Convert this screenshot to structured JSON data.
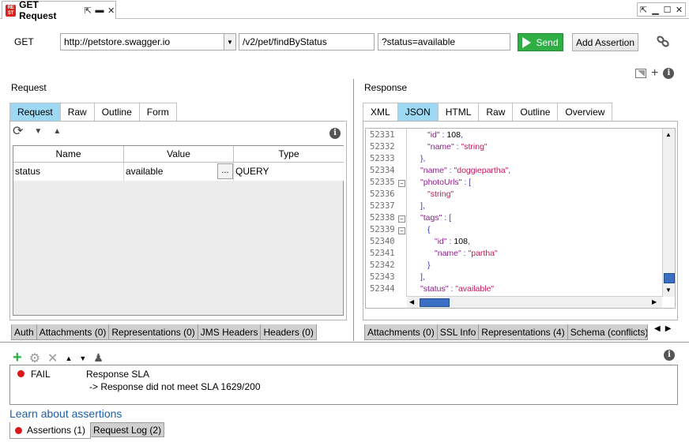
{
  "window": {
    "tab_title": "GET Request",
    "logo_text": "RE ST"
  },
  "request_line": {
    "method": "GET",
    "endpoint": "http://petstore.swagger.io",
    "resource": "/v2/pet/findByStatus",
    "query": "?status=available",
    "send_label": "Send",
    "add_assertion_label": "Add Assertion"
  },
  "request": {
    "section_title": "Request",
    "tabs": [
      "Request",
      "Raw",
      "Outline",
      "Form"
    ],
    "active_tab": "Request",
    "columns": [
      "Name",
      "Value",
      "Type"
    ],
    "rows": [
      {
        "name": "status",
        "value": "available",
        "type": "QUERY"
      }
    ],
    "ellipsis": "...",
    "bottom_tabs": [
      "Auth",
      "Attachments (0)",
      "Representations (0)",
      "JMS Headers",
      "Headers (0)"
    ]
  },
  "response": {
    "section_title": "Response",
    "tabs": [
      "XML",
      "JSON",
      "HTML",
      "Raw",
      "Outline",
      "Overview"
    ],
    "active_tab": "JSON",
    "lines": [
      {
        "no": "52331",
        "fold": false,
        "indent": 2,
        "key": "\"id\"",
        "sep": " : ",
        "val": "108",
        "vtype": "n",
        "tail": ","
      },
      {
        "no": "52332",
        "fold": false,
        "indent": 2,
        "key": "\"name\"",
        "sep": " : ",
        "val": "\"string\"",
        "vtype": "s",
        "tail": ""
      },
      {
        "no": "52333",
        "fold": false,
        "indent": 1,
        "key": "",
        "sep": "",
        "val": "},",
        "vtype": "p",
        "tail": ""
      },
      {
        "no": "52334",
        "fold": false,
        "indent": 1,
        "key": "\"name\"",
        "sep": " : ",
        "val": "\"doggiepartha\"",
        "vtype": "s",
        "tail": ","
      },
      {
        "no": "52335",
        "fold": true,
        "indent": 1,
        "key": "\"photoUrls\"",
        "sep": " : ",
        "val": "[",
        "vtype": "p",
        "tail": ""
      },
      {
        "no": "52336",
        "fold": false,
        "indent": 2,
        "key": "",
        "sep": "",
        "val": "\"string\"",
        "vtype": "s",
        "tail": ""
      },
      {
        "no": "52337",
        "fold": false,
        "indent": 1,
        "key": "",
        "sep": "",
        "val": "],",
        "vtype": "p",
        "tail": ""
      },
      {
        "no": "52338",
        "fold": true,
        "indent": 1,
        "key": "\"tags\"",
        "sep": " : ",
        "val": "[",
        "vtype": "p",
        "tail": ""
      },
      {
        "no": "52339",
        "fold": true,
        "indent": 2,
        "key": "",
        "sep": "",
        "val": "{",
        "vtype": "p",
        "tail": ""
      },
      {
        "no": "52340",
        "fold": false,
        "indent": 3,
        "key": "\"id\"",
        "sep": " : ",
        "val": "108",
        "vtype": "n",
        "tail": ","
      },
      {
        "no": "52341",
        "fold": false,
        "indent": 3,
        "key": "\"name\"",
        "sep": " : ",
        "val": "\"partha\"",
        "vtype": "s",
        "tail": ""
      },
      {
        "no": "52342",
        "fold": false,
        "indent": 2,
        "key": "",
        "sep": "",
        "val": "}",
        "vtype": "p",
        "tail": ""
      },
      {
        "no": "52343",
        "fold": false,
        "indent": 1,
        "key": "",
        "sep": "",
        "val": "],",
        "vtype": "p",
        "tail": ""
      },
      {
        "no": "52344",
        "fold": false,
        "indent": 1,
        "key": "\"status\"",
        "sep": " : ",
        "val": "\"available\"",
        "vtype": "s",
        "tail": ""
      }
    ],
    "bottom_tabs": [
      "Attachments (0)",
      "SSL Info",
      "Representations (4)",
      "Schema (conflicts)"
    ]
  },
  "assertions": {
    "items": [
      {
        "status": "FAIL",
        "title": "Response SLA",
        "detail": "-> Response did not meet SLA 1629/200"
      }
    ],
    "learn_link": "Learn about assertions",
    "bottom_tabs": [
      "Assertions (1)",
      "Request Log (2)"
    ]
  },
  "colors": {
    "active_tab": "#9dd9f3",
    "send_button": "#2eae44",
    "fail": "#d8181a",
    "json_key": "#8a1d8a",
    "json_string": "#c0185a",
    "link": "#1c5fa8"
  }
}
